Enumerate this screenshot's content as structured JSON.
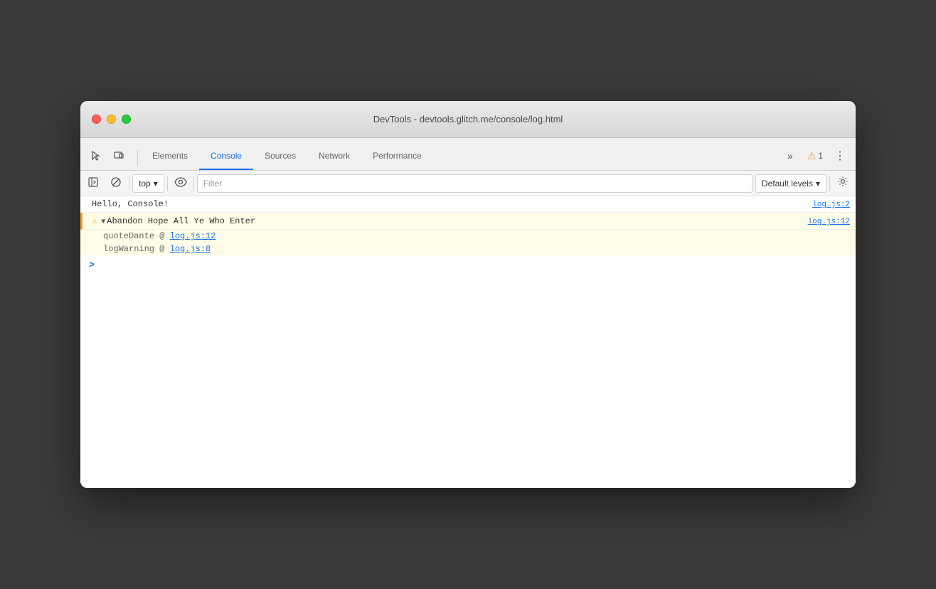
{
  "window": {
    "title": "DevTools - devtools.glitch.me/console/log.html"
  },
  "controls": {
    "close_label": "",
    "min_label": "",
    "max_label": ""
  },
  "tabbar": {
    "cursor_icon": "↖",
    "responsive_icon": "⊡",
    "tabs": [
      {
        "label": "Elements",
        "active": false
      },
      {
        "label": "Console",
        "active": true
      },
      {
        "label": "Sources",
        "active": false
      },
      {
        "label": "Network",
        "active": false
      },
      {
        "label": "Performance",
        "active": false
      }
    ],
    "more_icon": "»",
    "warning_count": "1",
    "menu_icon": "⋮"
  },
  "console_toolbar": {
    "sidebar_icon": "▶",
    "clear_icon": "⊘",
    "context_label": "top",
    "dropdown_arrow": "▾",
    "eye_icon": "👁",
    "filter_placeholder": "Filter",
    "levels_label": "Default levels",
    "levels_arrow": "▾",
    "settings_icon": "⚙"
  },
  "console_output": {
    "rows": [
      {
        "type": "info",
        "message": "Hello, Console!",
        "source": "log.js:2"
      }
    ],
    "warning_row": {
      "type": "warning",
      "message": "Abandon Hope All Ye Who Enter",
      "source": "log.js:12",
      "stack": [
        {
          "label": "quoteDante @ ",
          "link": "log.js:12"
        },
        {
          "label": "logWarning @ ",
          "link": "log.js:8"
        }
      ]
    },
    "cursor_prompt": ">"
  }
}
